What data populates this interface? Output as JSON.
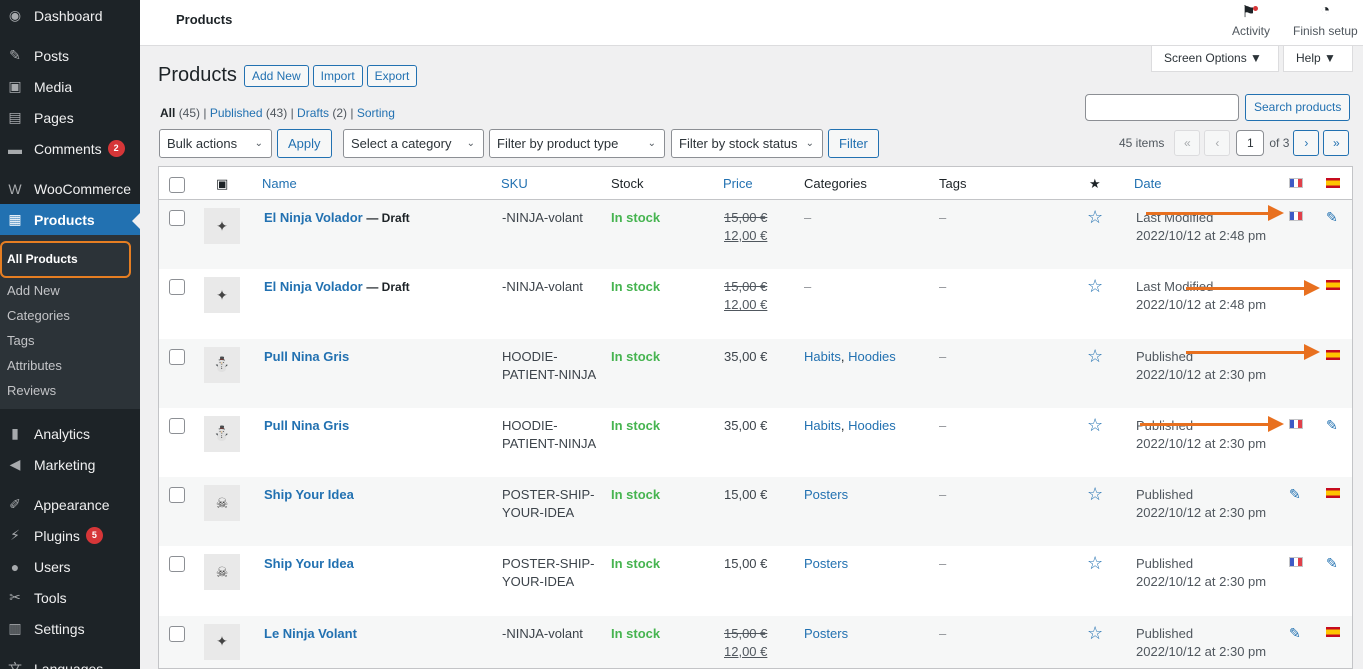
{
  "sidebar": {
    "items": [
      {
        "label": "Dashboard",
        "icon": "dashboard-icon",
        "glyph": "◉"
      },
      {
        "label": "Posts",
        "icon": "pin-icon",
        "glyph": "✎"
      },
      {
        "label": "Media",
        "icon": "media-icon",
        "glyph": "▣"
      },
      {
        "label": "Pages",
        "icon": "pages-icon",
        "glyph": "▤"
      },
      {
        "label": "Comments",
        "icon": "comment-icon",
        "glyph": "▬",
        "badge": "2"
      },
      {
        "label": "WooCommerce",
        "icon": "woo-icon",
        "glyph": "W"
      },
      {
        "label": "Products",
        "icon": "products-icon",
        "glyph": "▦"
      },
      {
        "label": "Analytics",
        "icon": "analytics-icon",
        "glyph": "▮"
      },
      {
        "label": "Marketing",
        "icon": "megaphone-icon",
        "glyph": "◀"
      },
      {
        "label": "Appearance",
        "icon": "brush-icon",
        "glyph": "✐"
      },
      {
        "label": "Plugins",
        "icon": "plugin-icon",
        "glyph": "⚡",
        "badge": "5"
      },
      {
        "label": "Users",
        "icon": "user-icon",
        "glyph": "●"
      },
      {
        "label": "Tools",
        "icon": "wrench-icon",
        "glyph": "✂"
      },
      {
        "label": "Settings",
        "icon": "settings-icon",
        "glyph": "▥"
      },
      {
        "label": "Languages",
        "icon": "languages-icon",
        "glyph": "文"
      }
    ],
    "submenu": [
      "All Products",
      "Add New",
      "Categories",
      "Tags",
      "Attributes",
      "Reviews"
    ]
  },
  "topbar": {
    "title": "Products",
    "activity_label": "Activity",
    "finish_setup_label": "Finish setup"
  },
  "screen_options_label": "Screen Options ▼",
  "help_label": "Help ▼",
  "heading": {
    "title": "Products",
    "add_new": "Add New",
    "import": "Import",
    "export": "Export"
  },
  "views": {
    "all": "All",
    "all_count": "(45)",
    "published": "Published",
    "published_count": "(43)",
    "drafts": "Drafts",
    "drafts_count": "(2)",
    "sorting": "Sorting"
  },
  "search": {
    "value": "",
    "button": "Search products"
  },
  "filters": {
    "bulk_actions": "Bulk actions",
    "apply": "Apply",
    "category": "Select a category",
    "product_type": "Filter by product type",
    "stock_status": "Filter by stock status",
    "filter": "Filter"
  },
  "pagination": {
    "count": "45 items",
    "first": "«",
    "prev": "‹",
    "current": "1",
    "of": "of 3",
    "next": "›",
    "last": "»"
  },
  "table": {
    "columns": {
      "name": "Name",
      "sku": "SKU",
      "stock": "Stock",
      "price": "Price",
      "categories": "Categories",
      "tags": "Tags",
      "date": "Date"
    },
    "rows": [
      {
        "name": "El Ninja Volador",
        "draft": "— Draft",
        "sku1": "-NINJA-volant",
        "sku2": "",
        "stock": "In stock",
        "price_old": "15,00 €",
        "price": "12,00 €",
        "cats": [],
        "cat_empty": "–",
        "tags": "–",
        "date_label": "Last Modified",
        "date": "2022/10/12 at 2:48 pm",
        "fr": "flag",
        "es": "pencil",
        "thumb": "tshirt"
      },
      {
        "name": "El Ninja Volador",
        "draft": "— Draft",
        "sku1": "-NINJA-volant",
        "sku2": "",
        "stock": "In stock",
        "price_old": "15,00 €",
        "price": "12,00 €",
        "cats": [],
        "cat_empty": "–",
        "tags": "–",
        "date_label": "Last Modified",
        "date": "2022/10/12 at 2:48 pm",
        "fr": "none",
        "es": "flag",
        "thumb": "tshirt"
      },
      {
        "name": "Pull Nina Gris",
        "draft": "",
        "sku1": "HOODIE-",
        "sku2": "PATIENT-NINJA",
        "stock": "In stock",
        "price_old": "",
        "price": "35,00 €",
        "cats": [
          "Habits",
          "Hoodies"
        ],
        "cat_empty": "",
        "tags": "–",
        "date_label": "Published",
        "date": "2022/10/12 at 2:30 pm",
        "fr": "none",
        "es": "flag",
        "thumb": "hoodie"
      },
      {
        "name": "Pull Nina Gris",
        "draft": "",
        "sku1": "HOODIE-",
        "sku2": "PATIENT-NINJA",
        "stock": "In stock",
        "price_old": "",
        "price": "35,00 €",
        "cats": [
          "Habits",
          "Hoodies"
        ],
        "cat_empty": "",
        "tags": "–",
        "date_label": "Published",
        "date": "2022/10/12 at 2:30 pm",
        "fr": "flag",
        "es": "pencil",
        "thumb": "hoodie"
      },
      {
        "name": "Ship Your Idea",
        "draft": "",
        "sku1": "POSTER-SHIP-",
        "sku2": "YOUR-IDEA",
        "stock": "In stock",
        "price_old": "",
        "price": "15,00 €",
        "cats": [
          "Posters"
        ],
        "cat_empty": "",
        "tags": "–",
        "date_label": "Published",
        "date": "2022/10/12 at 2:30 pm",
        "fr": "pencil",
        "es": "flag",
        "thumb": "poster"
      },
      {
        "name": "Ship Your Idea",
        "draft": "",
        "sku1": "POSTER-SHIP-",
        "sku2": "YOUR-IDEA",
        "stock": "In stock",
        "price_old": "",
        "price": "15,00 €",
        "cats": [
          "Posters"
        ],
        "cat_empty": "",
        "tags": "–",
        "date_label": "Published",
        "date": "2022/10/12 at 2:30 pm",
        "fr": "flag",
        "es": "pencil",
        "thumb": "poster"
      },
      {
        "name": "Le Ninja Volant",
        "draft": "",
        "sku1": "-NINJA-volant",
        "sku2": "",
        "stock": "In stock",
        "price_old": "15,00 €",
        "price": "12,00 €",
        "cats": [
          "Posters"
        ],
        "cat_empty": "",
        "tags": "–",
        "date_label": "Published",
        "date": "2022/10/12 at 2:30 pm",
        "fr": "pencil",
        "es": "flag",
        "thumb": "tshirt"
      }
    ]
  },
  "colors": {
    "accent": "#2271b1",
    "annotation": "#e8701f",
    "instock": "#46b450"
  }
}
